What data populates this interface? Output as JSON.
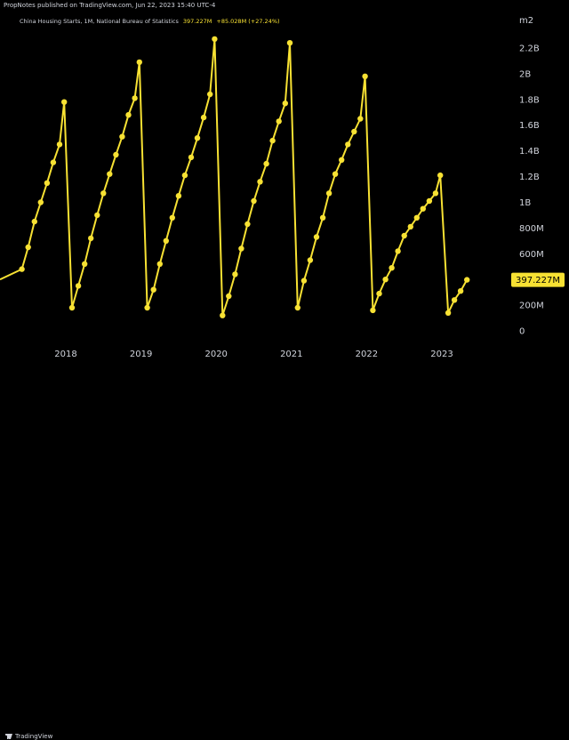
{
  "header": {
    "publish_text": "PropNotes published on TradingView.com, Jun 22, 2023 15:40 UTC-4"
  },
  "legend": {
    "symbol": "China Housing Starts, 1M, National Bureau of Statistics",
    "last": "397.227M",
    "change": "+85.028M (+27.24%)"
  },
  "footer": {
    "brand": "TradingView"
  },
  "colors": {
    "background": "#000000",
    "line": "#f7e133",
    "axis_text": "#d1d4dc",
    "price_tag_bg": "#f7e133",
    "price_tag_text": "#000000"
  },
  "chart_data": {
    "type": "line",
    "title": "",
    "unit_label": "m2",
    "xlabel": "",
    "ylabel": "",
    "ylim": [
      -100000000,
      2400000000
    ],
    "y_ticks": [
      {
        "value": 0,
        "label": "0"
      },
      {
        "value": 200000000,
        "label": "200M"
      },
      {
        "value": 600000000,
        "label": "600M"
      },
      {
        "value": 800000000,
        "label": "800M"
      },
      {
        "value": 1000000000,
        "label": "1B"
      },
      {
        "value": 1200000000,
        "label": "1.2B"
      },
      {
        "value": 1400000000,
        "label": "1.4B"
      },
      {
        "value": 1600000000,
        "label": "1.6B"
      },
      {
        "value": 1800000000,
        "label": "1.8B"
      },
      {
        "value": 2000000000,
        "label": "2B"
      },
      {
        "value": 2200000000,
        "label": "2.2B"
      }
    ],
    "x_range": [
      "2017-06",
      "2023-08"
    ],
    "x_ticks": [
      "2018",
      "2019",
      "2020",
      "2021",
      "2022",
      "2023"
    ],
    "grid": false,
    "last_value_label": "397.227M",
    "last_value": 397227000,
    "series": [
      {
        "dates": [
          "2017-06",
          "2017-07",
          "2017-08",
          "2017-09",
          "2017-10",
          "2017-11",
          "2017-12",
          "2018-02",
          "2018-03",
          "2018-04",
          "2018-05",
          "2018-06",
          "2018-07",
          "2018-08",
          "2018-09",
          "2018-10",
          "2018-11",
          "2018-12",
          "2019-02",
          "2019-03",
          "2019-04",
          "2019-05",
          "2019-06",
          "2019-07",
          "2019-08",
          "2019-09",
          "2019-10",
          "2019-11",
          "2019-12",
          "2020-02",
          "2020-03",
          "2020-04",
          "2020-05",
          "2020-06",
          "2020-07",
          "2020-08",
          "2020-09",
          "2020-10",
          "2020-11",
          "2020-12",
          "2021-02",
          "2021-03",
          "2021-04",
          "2021-05",
          "2021-06",
          "2021-07",
          "2021-08",
          "2021-09",
          "2021-10",
          "2021-11",
          "2021-12",
          "2022-02",
          "2022-03",
          "2022-04",
          "2022-05",
          "2022-06",
          "2022-07",
          "2022-08",
          "2022-09",
          "2022-10",
          "2022-11",
          "2022-12",
          "2023-02",
          "2023-03",
          "2023-04",
          "2023-05"
        ],
        "values": [
          480000000,
          650000000,
          850000000,
          1000000000,
          1150000000,
          1310000000,
          1450000000,
          180000000,
          350000000,
          520000000,
          720000000,
          900000000,
          1070000000,
          1220000000,
          1370000000,
          1510000000,
          1680000000,
          1810000000,
          180000000,
          320000000,
          520000000,
          700000000,
          880000000,
          1050000000,
          1210000000,
          1350000000,
          1500000000,
          1660000000,
          1840000000,
          120000000,
          270000000,
          440000000,
          640000000,
          830000000,
          1010000000,
          1160000000,
          1300000000,
          1480000000,
          1630000000,
          1770000000,
          180000000,
          390000000,
          550000000,
          730000000,
          880000000,
          1070000000,
          1220000000,
          1330000000,
          1450000000,
          1550000000,
          1650000000,
          160000000,
          290000000,
          400000000,
          490000000,
          620000000,
          740000000,
          810000000,
          880000000,
          950000000,
          1010000000,
          1070000000,
          140000000,
          240000000,
          310000000,
          397227000
        ],
        "peaks": [
          {
            "date": "2017-12",
            "value": 1780000000
          },
          {
            "date": "2018-12",
            "value": 2090000000
          },
          {
            "date": "2019-12",
            "value": 2270000000
          },
          {
            "date": "2020-12",
            "value": 2240000000
          },
          {
            "date": "2021-12",
            "value": 1980000000
          },
          {
            "date": "2022-12",
            "value": 1210000000
          }
        ]
      }
    ]
  }
}
